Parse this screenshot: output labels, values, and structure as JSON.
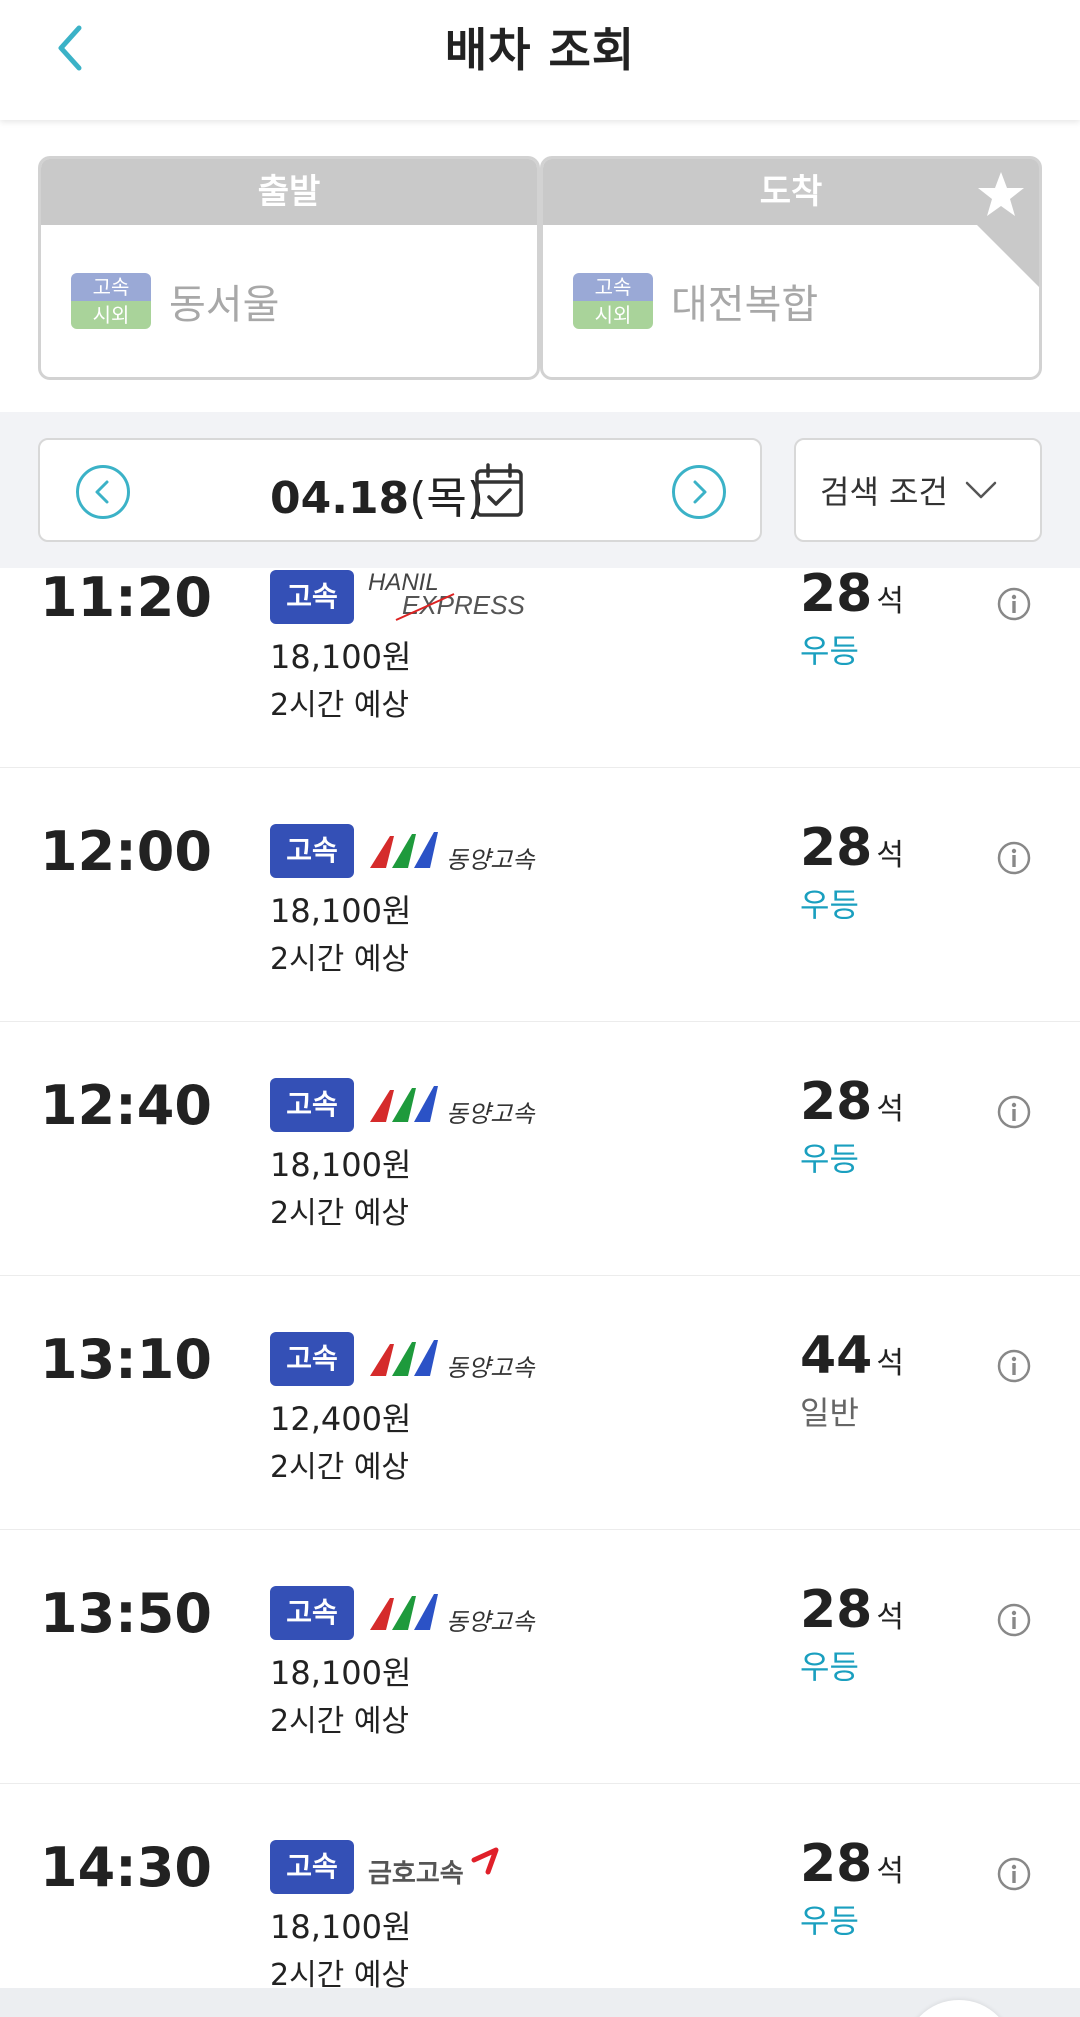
{
  "header": {
    "title": "배차 조회"
  },
  "route": {
    "departure": {
      "label": "출발",
      "mode_top": "고속",
      "mode_bottom": "시외",
      "station": "동서울"
    },
    "arrival": {
      "label": "도착",
      "mode_top": "고속",
      "mode_bottom": "시외",
      "station": "대전복합"
    }
  },
  "date_bar": {
    "date": "04.18",
    "weekday": "(목)",
    "filter_label": "검색 조건"
  },
  "colors": {
    "accent": "#3bb2c7",
    "grade_tag": "#3450b6",
    "premium_class": "#1a9fbf"
  },
  "schedules": [
    {
      "time": "11:20",
      "grade": "고속",
      "company": "HANIL EXPRESS",
      "logo": "hanil-express-logo",
      "fare": "18,100원",
      "duration": "2시간 예상",
      "seats": "28",
      "seat_unit": "석",
      "class": "우등",
      "class_type": "premium"
    },
    {
      "time": "12:00",
      "grade": "고속",
      "company": "동양고속",
      "logo": "dongyang-logo",
      "fare": "18,100원",
      "duration": "2시간 예상",
      "seats": "28",
      "seat_unit": "석",
      "class": "우등",
      "class_type": "premium"
    },
    {
      "time": "12:40",
      "grade": "고속",
      "company": "동양고속",
      "logo": "dongyang-logo",
      "fare": "18,100원",
      "duration": "2시간 예상",
      "seats": "28",
      "seat_unit": "석",
      "class": "우등",
      "class_type": "premium"
    },
    {
      "time": "13:10",
      "grade": "고속",
      "company": "동양고속",
      "logo": "dongyang-logo",
      "fare": "12,400원",
      "duration": "2시간 예상",
      "seats": "44",
      "seat_unit": "석",
      "class": "일반",
      "class_type": "normal"
    },
    {
      "time": "13:50",
      "grade": "고속",
      "company": "동양고속",
      "logo": "dongyang-logo",
      "fare": "18,100원",
      "duration": "2시간 예상",
      "seats": "28",
      "seat_unit": "석",
      "class": "우등",
      "class_type": "premium"
    },
    {
      "time": "14:30",
      "grade": "고속",
      "company": "금호고속",
      "logo": "kumho-logo",
      "fare": "18,100원",
      "duration": "2시간 예상",
      "seats": "28",
      "seat_unit": "석",
      "class": "우등",
      "class_type": "premium"
    }
  ]
}
